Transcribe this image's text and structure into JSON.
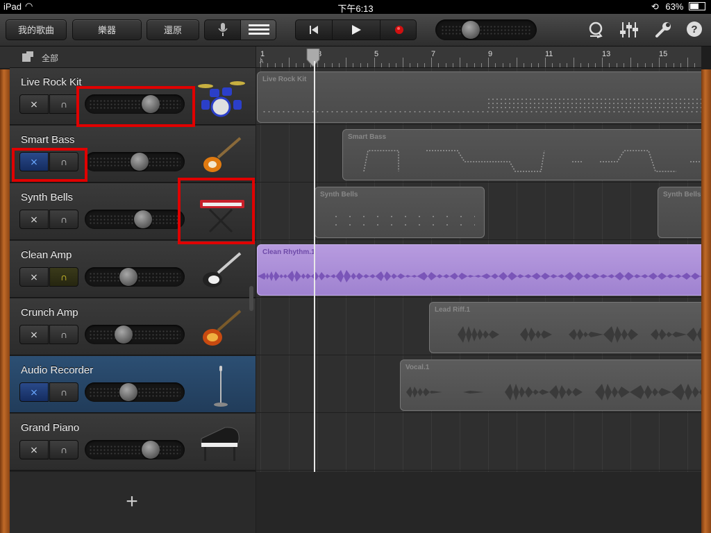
{
  "status": {
    "device": "iPad",
    "time": "下午6:13",
    "battery": "63%"
  },
  "toolbar": {
    "my_songs": "我的歌曲",
    "instruments": "樂器",
    "undo": "還原",
    "icons": [
      "mic-icon",
      "tracks-view-icon",
      "go-to-start-icon",
      "play-icon",
      "record-icon",
      "loop-icon",
      "mixer-icon",
      "wrench-icon",
      "help-icon"
    ]
  },
  "tracks_header": {
    "label": "全部"
  },
  "ruler": {
    "bars": [
      "1",
      "3",
      "5",
      "7",
      "9",
      "11",
      "13",
      "15"
    ],
    "marker": "A"
  },
  "tracks": [
    {
      "name": "Live Rock Kit",
      "mute": false,
      "solo": false,
      "volume": 0.7,
      "instrument_icon": "drum-kit-icon",
      "selected": false
    },
    {
      "name": "Smart Bass",
      "mute": true,
      "solo": false,
      "volume": 0.56,
      "instrument_icon": "bass-guitar-icon",
      "selected": false
    },
    {
      "name": "Synth Bells",
      "mute": false,
      "solo": false,
      "volume": 0.6,
      "instrument_icon": "keyboard-icon",
      "selected": false
    },
    {
      "name": "Clean Amp",
      "mute": false,
      "solo": true,
      "volume": 0.42,
      "instrument_icon": "electric-guitar-icon",
      "selected": false
    },
    {
      "name": "Crunch Amp",
      "mute": false,
      "solo": false,
      "volume": 0.36,
      "instrument_icon": "les-paul-guitar-icon",
      "selected": false
    },
    {
      "name": "Audio Recorder",
      "mute": true,
      "solo": false,
      "volume": 0.42,
      "instrument_icon": "microphone-stand-icon",
      "selected": true
    },
    {
      "name": "Grand Piano",
      "mute": false,
      "solo": false,
      "volume": 0.7,
      "instrument_icon": "grand-piano-icon",
      "selected": false
    }
  ],
  "regions": [
    {
      "lane": 0,
      "label": "Live Rock Kit",
      "kind": "midi"
    },
    {
      "lane": 1,
      "label": "Smart Bass",
      "kind": "midi"
    },
    {
      "lane": 2,
      "label": "Synth Bells",
      "kind": "midi"
    },
    {
      "lane": 2,
      "label": "Synth Bells",
      "kind": "midi"
    },
    {
      "lane": 3,
      "label": "Clean Rhythm.1",
      "kind": "purple"
    },
    {
      "lane": 4,
      "label": "Lead Riff.1",
      "kind": "audio"
    },
    {
      "lane": 5,
      "label": "Vocal.1",
      "kind": "audio"
    }
  ],
  "add_track": "+"
}
